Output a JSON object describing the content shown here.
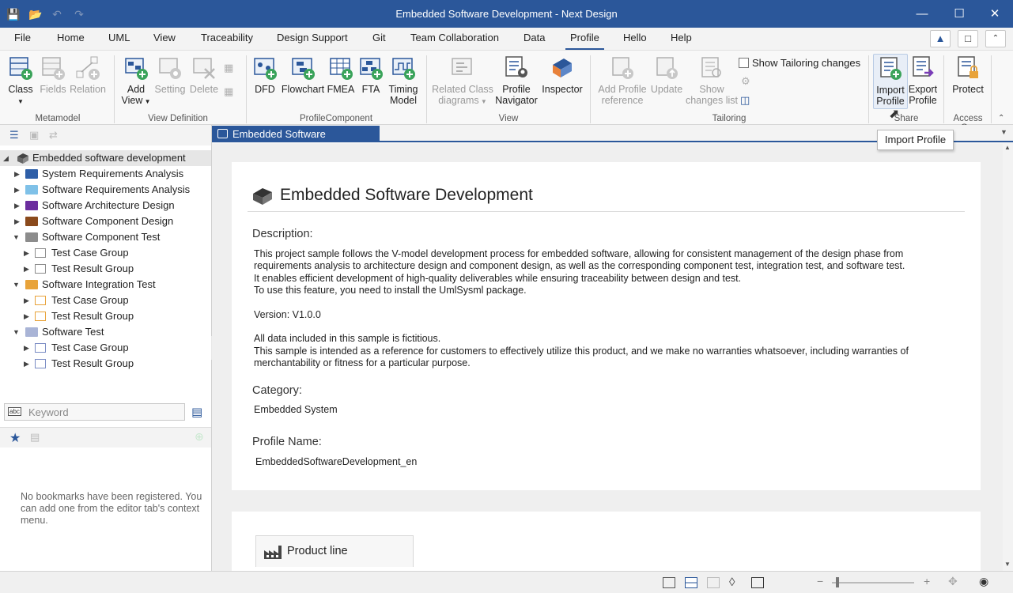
{
  "window": {
    "title": "Embedded Software Development - Next Design"
  },
  "menu": [
    "File",
    "Home",
    "UML",
    "View",
    "Traceability",
    "Design Support",
    "Git",
    "Team Collaboration",
    "Data",
    "Profile",
    "Hello",
    "Help"
  ],
  "ribbon": {
    "class_label": "Class",
    "fields_label": "Fields",
    "relation_label": "Relation",
    "add_view_label": "Add",
    "add_view_label2": "View",
    "setting_label": "Setting",
    "delete_label": "Delete",
    "dfd_label": "DFD",
    "flowchart_label": "Flowchart",
    "fmea_label": "FMEA",
    "fta_label": "FTA",
    "timing_label": "Timing",
    "timing_label2": "Model",
    "related_label": "Related Class",
    "related_label2": "diagrams",
    "profile_nav_label": "Profile",
    "profile_nav_label2": "Navigator",
    "inspector_label": "Inspector",
    "add_profile_ref_label": "Add Profile",
    "add_profile_ref_label2": "reference",
    "update_label": "Update",
    "show_changes_label": "Show",
    "show_changes_label2": "changes list",
    "show_tailoring_label": "Show Tailoring changes",
    "import_label": "Import",
    "import_label2": "Profile",
    "export_label": "Export",
    "export_label2": "Profile",
    "protect_label": "Protect",
    "groups": {
      "metamodel": "Metamodel",
      "view_definition": "View Definition",
      "profile_component": "ProfileComponent",
      "view": "View",
      "tailoring": "Tailoring",
      "share": "Share",
      "access": "Access C..."
    }
  },
  "tooltip": "Import Profile",
  "tree": {
    "root": "Embedded software development",
    "items": [
      {
        "label": "System Requirements Analysis"
      },
      {
        "label": "Software Requirements Analysis"
      },
      {
        "label": "Software Architecture Design"
      },
      {
        "label": "Software Component Design"
      },
      {
        "label": "Software Component Test"
      },
      {
        "label": "Test Case Group"
      },
      {
        "label": "Test Result Group"
      },
      {
        "label": "Software Integration Test"
      },
      {
        "label": "Test Case Group"
      },
      {
        "label": "Test Result Group"
      },
      {
        "label": "Software Test"
      },
      {
        "label": "Test Case Group"
      },
      {
        "label": "Test Result Group"
      }
    ]
  },
  "search": {
    "placeholder": "Keyword"
  },
  "bookmarks": {
    "empty_message": "No bookmarks have been registered. You can add one from the editor tab's context menu."
  },
  "editor": {
    "tab_label": "Embedded Software Development",
    "heading": "Embedded Software Development",
    "description_label": "Description:",
    "description_lines": [
      "This project sample follows the V-model development process for embedded software, allowing for consistent management of the design phase from",
      "requirements analysis to architecture design and component design, as well as the corresponding component test, integration test, and software test.",
      "It enables efficient development of high-quality deliverables while ensuring traceability between design and test.",
      "To use this feature, you need to install the UmlSysml package."
    ],
    "version": "Version: V1.0.0",
    "disclaimer_lines": [
      "All data included in this sample is fictitious.",
      "This sample is intended as a reference for customers to effectively utilize this product, and we make no warranties whatsoever, including warranties of",
      "merchantability or fitness for a particular purpose."
    ],
    "category_label": "Category:",
    "category_value": "Embedded System",
    "profile_name_label": "Profile Name:",
    "profile_name_value": "EmbeddedSoftwareDevelopment_en",
    "product_line_label": "Product line"
  },
  "colors": {
    "accent": "#2b579a",
    "add_green": "#3aa35a"
  }
}
